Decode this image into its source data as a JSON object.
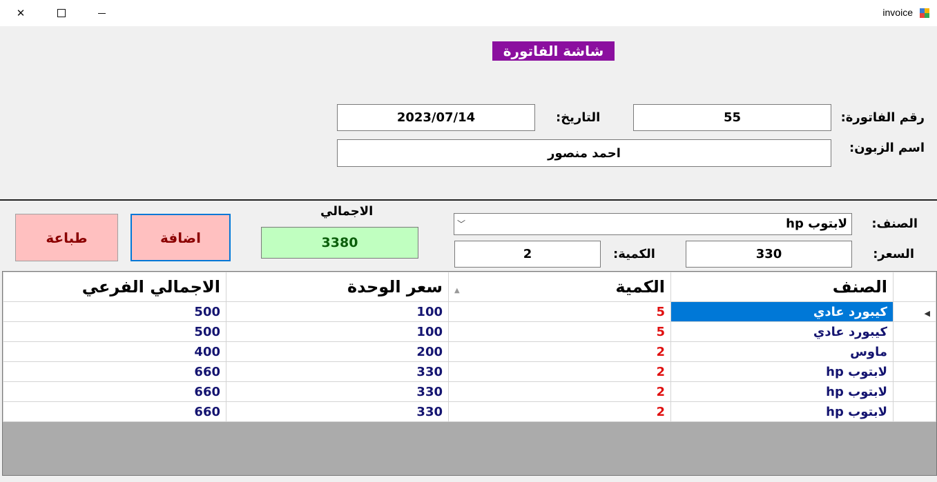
{
  "window": {
    "title": "invoice"
  },
  "form": {
    "heading": "شاشة الفاتورة",
    "invoice_no_label": "رقم الفاتورة:",
    "invoice_no": "55",
    "date_label": "التاريخ:",
    "date": "2023/07/14",
    "customer_label": "اسم الزبون:",
    "customer": "احمد منصور"
  },
  "entry": {
    "item_label": "الصنف:",
    "item_selected": "لابتوب hp",
    "price_label": "السعر:",
    "price": "330",
    "qty_label": "الكمية:",
    "qty": "2",
    "total_label": "الاجمالي",
    "total": "3380",
    "add_label": "اضافة",
    "print_label": "طباعة"
  },
  "grid": {
    "columns": {
      "subtotal": "الاجمالي الفرعي",
      "unit_price": "سعر الوحدة",
      "qty": "الكمية",
      "item": "الصنف"
    },
    "rows": [
      {
        "item": "كيبورد عادي",
        "qty": "5",
        "price": "100",
        "subtotal": "500"
      },
      {
        "item": "كيبورد عادي",
        "qty": "5",
        "price": "100",
        "subtotal": "500"
      },
      {
        "item": "ماوس",
        "qty": "2",
        "price": "200",
        "subtotal": "400"
      },
      {
        "item": "لابتوب hp",
        "qty": "2",
        "price": "330",
        "subtotal": "660"
      },
      {
        "item": "لابتوب hp",
        "qty": "2",
        "price": "330",
        "subtotal": "660"
      },
      {
        "item": "لابتوب hp",
        "qty": "2",
        "price": "330",
        "subtotal": "660"
      }
    ]
  },
  "colors": {
    "heading_bg": "#8b0f9f",
    "total_bg": "#c0ffc0",
    "button_bg": "#ffc0c0",
    "selection": "#0078d7"
  }
}
